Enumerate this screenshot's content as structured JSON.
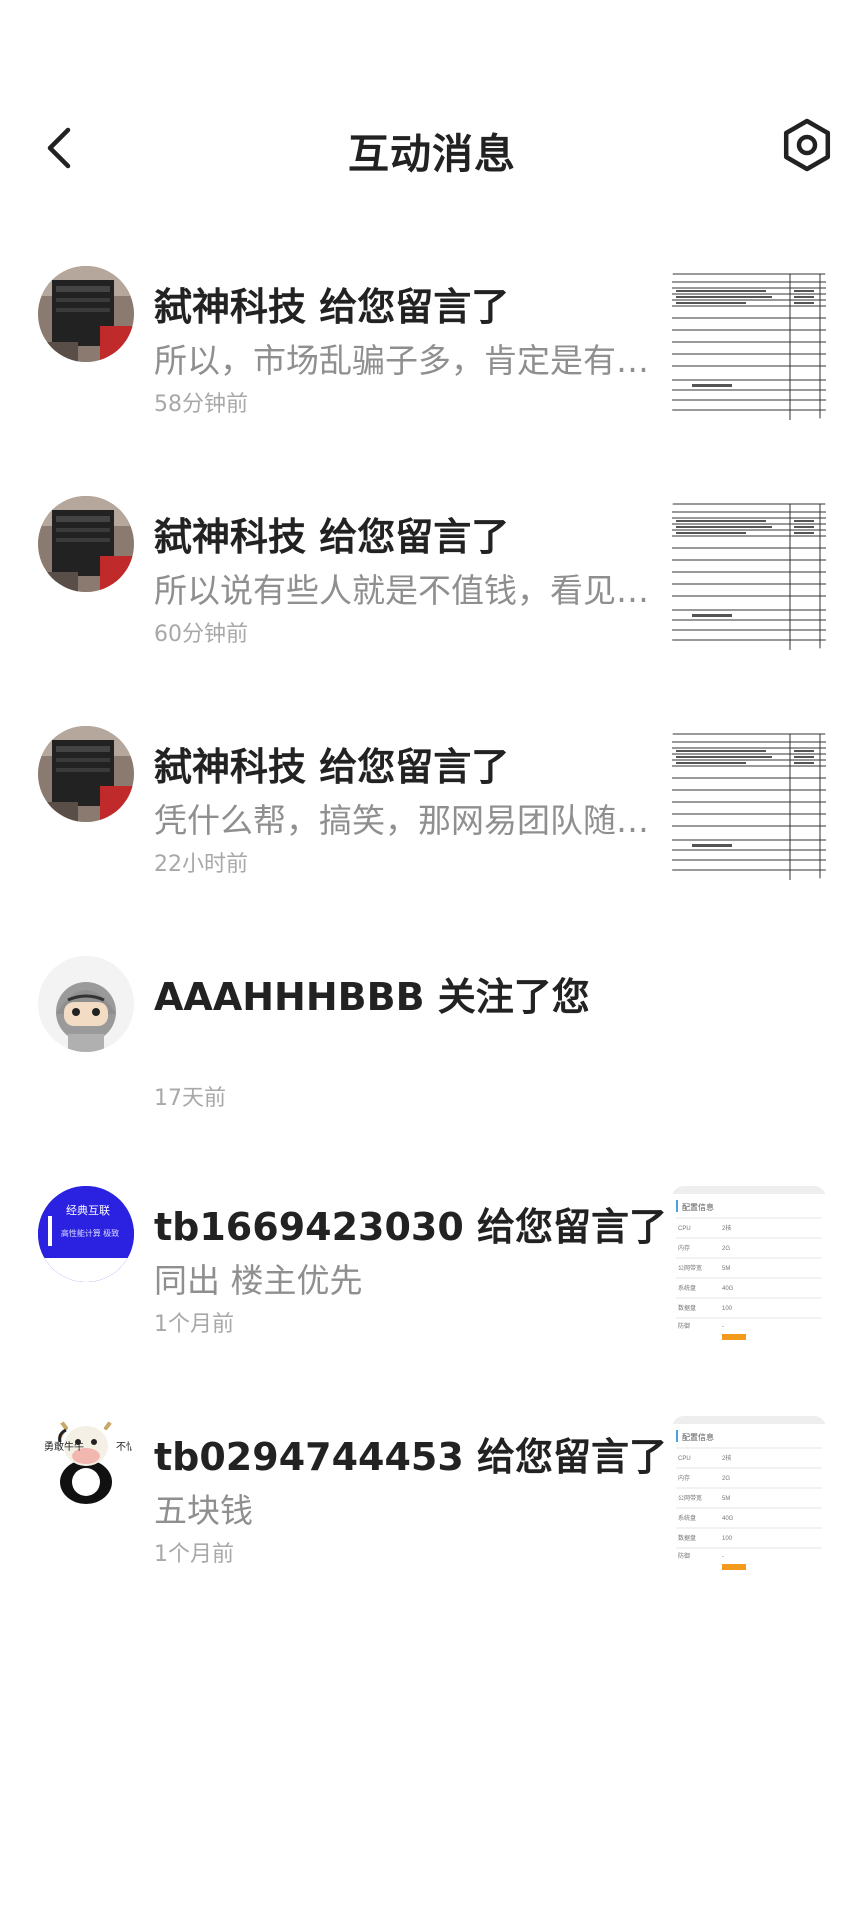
{
  "header": {
    "title": "互动消息"
  },
  "notifications": [
    {
      "title": "弑神科技 给您留言了",
      "preview": "所以，市场乱骗子多，肯定是有…",
      "time": "58分钟前",
      "avatar": "server-photo",
      "thumbnail": "spreadsheet-screenshot"
    },
    {
      "title": "弑神科技 给您留言了",
      "preview": "所以说有些人就是不值钱，看见…",
      "time": "60分钟前",
      "avatar": "server-photo",
      "thumbnail": "spreadsheet-screenshot"
    },
    {
      "title": "弑神科技 给您留言了",
      "preview": "凭什么帮，搞笑，那网易团队随…",
      "time": "22小时前",
      "avatar": "server-photo",
      "thumbnail": "spreadsheet-screenshot"
    },
    {
      "title": "AAAHHHBBB 关注了您",
      "preview": "",
      "time": "17天前",
      "avatar": "ninja-cartoon",
      "thumbnail": ""
    },
    {
      "title": "tb1669423030 给您留言了",
      "preview": "同出 楼主优先",
      "time": "1个月前",
      "avatar": "blue-banner",
      "avatar_text": "经典互联",
      "avatar_subtext": "高性能计算 极致",
      "thumbnail": "config-list-screenshot"
    },
    {
      "title": "tb0294744453 给您留言了",
      "preview": "五块钱",
      "time": "1个月前",
      "avatar": "cow-cartoon",
      "avatar_text_left": "勇敢牛牛",
      "avatar_text_right": "不怕困难",
      "thumbnail": "config-list-screenshot"
    }
  ],
  "thumbnails": {
    "spreadsheet": {
      "header_left": "购买订单明细",
      "footer_text": "收货日期: 11"
    },
    "config": {
      "heading": "配置信息",
      "rows": [
        {
          "label": "CPU",
          "value": "2核"
        },
        {
          "label": "内存",
          "value": "2G"
        },
        {
          "label": "公网带宽",
          "value": "5M"
        },
        {
          "label": "系统盘",
          "value": "40G"
        },
        {
          "label": "数据盘",
          "value": "100"
        },
        {
          "label": "防御",
          "value": "-"
        },
        {
          "label": "价格",
          "value": ""
        }
      ]
    }
  },
  "colors": {
    "title": "#222222",
    "preview": "#8f8f8f",
    "time": "#a8a8a8",
    "avatar_blue": "#2a22e0",
    "badge_orange": "#f39a1c"
  }
}
